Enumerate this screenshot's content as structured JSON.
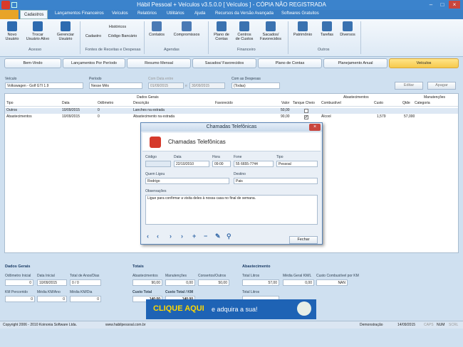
{
  "title": "Hábil Pessoal + Veículos v3.5.0.0 [ Veículos ] - CÓPIA NÃO REGISTRADA",
  "menu": [
    "Cadastros",
    "Lançamentos Financeiros",
    "Veículos",
    "Relatórios",
    "Utilitários",
    "Ajuda",
    "Recursos da Versão Avançada",
    "Softwares Gratuitos"
  ],
  "ribbon": {
    "buttons": [
      {
        "label": "Novo\nUsuário"
      },
      {
        "label": "Trocar\nUsuário Ativo"
      },
      {
        "label": "Gerenciar\nUsuário"
      },
      {
        "label": "Cadastro"
      },
      {
        "label": "Históricos"
      },
      {
        "label": "Código Bancário"
      },
      {
        "label": "Contatos"
      },
      {
        "label": "Compromissos"
      },
      {
        "label": "Plano de\nContas"
      },
      {
        "label": "Centros\nde Custos"
      },
      {
        "label": "Sacados/\nFavorecidos"
      },
      {
        "label": "Patrimônio"
      },
      {
        "label": "Tarefas"
      },
      {
        "label": "Diversos"
      }
    ],
    "groups": [
      "Acesso",
      "Fontes de Receitas e Despesas",
      "Agendas",
      "Financeiro",
      "Outros"
    ]
  },
  "tabs": [
    "Bem-Vindo",
    "Lançamentos Por Período",
    "Resumo Mensal",
    "Sacados/ Favorecidos",
    "Plano de Contas",
    "Planejamento Anual",
    "Veículos"
  ],
  "filters": {
    "veiculo_label": "Veículo",
    "veiculo": "Volkswagen - Golf GTI 1.9",
    "periodo_label": "Período",
    "periodo": "Nesse Mês",
    "com_data_label": "Com Data entre",
    "data_ini": "01/09/2015",
    "e": "e",
    "data_fim": "30/09/2015",
    "despesas_label": "Com as Despesas",
    "despesas": "(Todas)",
    "editar": "Editar",
    "apagar": "Apagar"
  },
  "grid": {
    "groups": [
      "Dados Gerais",
      "Abastecimentos",
      "Manutenções"
    ],
    "headers": [
      "Tipo",
      "Data",
      "Odômetro",
      "Descrição",
      "Favorecido",
      "Valor",
      "Tanque Cheio",
      "Combustível",
      "Custo",
      "Qtde",
      "Categoria"
    ],
    "rows": [
      [
        "Outros",
        "10/09/2015",
        "0",
        "Lanches na estrada",
        "",
        "50,00",
        "",
        "",
        "",
        "",
        ""
      ],
      [
        "Abastecimentos",
        "10/09/2015",
        "0",
        "Abastecimento na estrada",
        "",
        "90,00",
        "",
        "Álcool",
        "1,579",
        "57,000",
        ""
      ]
    ]
  },
  "dialog": {
    "title": "Chamadas Telefônicas",
    "header": "Chamadas Telefônicas",
    "codigo_label": "Código",
    "data_label": "Data",
    "data": "22/10/2010",
    "hora_label": "Hora",
    "hora": "09:00",
    "fone_label": "Fone",
    "fone": "55 6655-7744",
    "tipo_label": "Tipo",
    "tipo": "Pessoal",
    "quem_label": "Quem Ligou",
    "quem": "Rodrigo",
    "destino_label": "Destino",
    "destino": "Pais",
    "obs_label": "Observações",
    "obs": "Ligue para confirmar a visita deles à nossa casa no final de semana.",
    "fechar": "Fechar"
  },
  "bottom": {
    "dados_gerais": "Dados Gerais",
    "totais": "Totais",
    "abastecimento": "Abastecimento",
    "odometro_label": "Odômetro Inicial",
    "odometro": "0",
    "data_inicial_label": "Data Inicial",
    "data_inicial": "10/09/2015",
    "total_anos_label": "Total de Anos/Dias",
    "total_anos": "0 / 0",
    "km_perc_label": "KM Percorrido",
    "km_perc": "0",
    "media_ano_label": "Média KM/Ano",
    "media_ano": "0",
    "media_dia_label": "Média KM/Dia",
    "media_dia": "0",
    "abast_label": "Abastecimentos",
    "abast": "90,00",
    "manut_label": "Manutenções",
    "manut": "0,00",
    "consertos_label": "Consertos/Outros",
    "consertos": "50,00",
    "custo_total_label": "Custo Total",
    "custo_total": "140,00",
    "custo_km_label": "Custo Total / KM",
    "custo_km": "140,00",
    "total_litros_label": "Total Litros",
    "total_litros": "57,00",
    "media_kml_label": "Média Geral KM/L",
    "media_kml": "0,00",
    "custo_comb_label": "Custo Combustível por KM",
    "custo_comb": "NAN",
    "total_litros2_label": "Total Litros"
  },
  "banner": {
    "text": "CLIQUE AQUI",
    "text2": "e adquira a sua!"
  },
  "status": {
    "copyright": "Copyright 2006 - 2010 Koinonia Software Ltda.",
    "site": "www.habilpessoal.com.br",
    "mode": "Demonstração",
    "date": "14/09/2015",
    "caps": "CAPS",
    "num": "NUM",
    "scrl": "SCRL"
  }
}
